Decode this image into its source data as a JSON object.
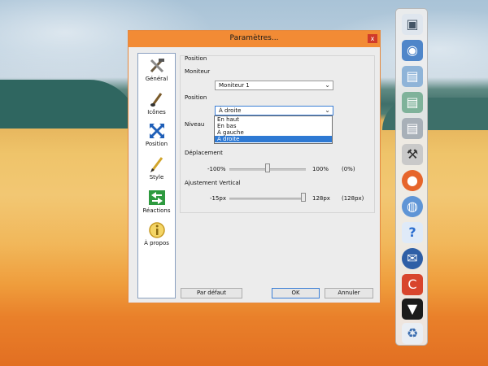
{
  "window": {
    "title": "Paramètres...",
    "close_glyph": "x"
  },
  "sidebar": {
    "items": [
      {
        "label": "Général",
        "icon": "tools-icon"
      },
      {
        "label": "Icônes",
        "icon": "brush-icon"
      },
      {
        "label": "Position",
        "icon": "arrows-icon"
      },
      {
        "label": "Style",
        "icon": "pen-icon"
      },
      {
        "label": "Réactions",
        "icon": "swap-arrows-icon"
      },
      {
        "label": "À propos",
        "icon": "info-icon"
      }
    ]
  },
  "panel": {
    "group_title": "Position",
    "monitor_label": "Moniteur",
    "monitor_value": "Moniteur 1",
    "position_label": "Position",
    "position_value": "À droite",
    "level_label": "Niveau",
    "dropdown_options": [
      "En haut",
      "En bas",
      "À gauche",
      "À droite"
    ],
    "selected_option": "À droite",
    "displacement": {
      "label": "Déplacement",
      "min": "-100%",
      "max": "100%",
      "current": "(0%)",
      "value": 0
    },
    "vertical": {
      "label": "Ajustement Vertical",
      "min": "-15px",
      "max": "128px",
      "current": "(128px)",
      "value": 128
    }
  },
  "buttons": {
    "defaults": "Par défaut",
    "ok": "OK",
    "cancel": "Annuler"
  },
  "dock": {
    "icons": [
      "finder-icon",
      "network-globe-icon",
      "folder-icon",
      "folder-green-icon",
      "folder-grey-icon",
      "tools-app-icon",
      "firefox-icon",
      "globe-icon",
      "help-icon",
      "thunderbird-icon",
      "ccleaner-icon",
      "tshirt-icon",
      "recycle-bin-icon"
    ]
  }
}
